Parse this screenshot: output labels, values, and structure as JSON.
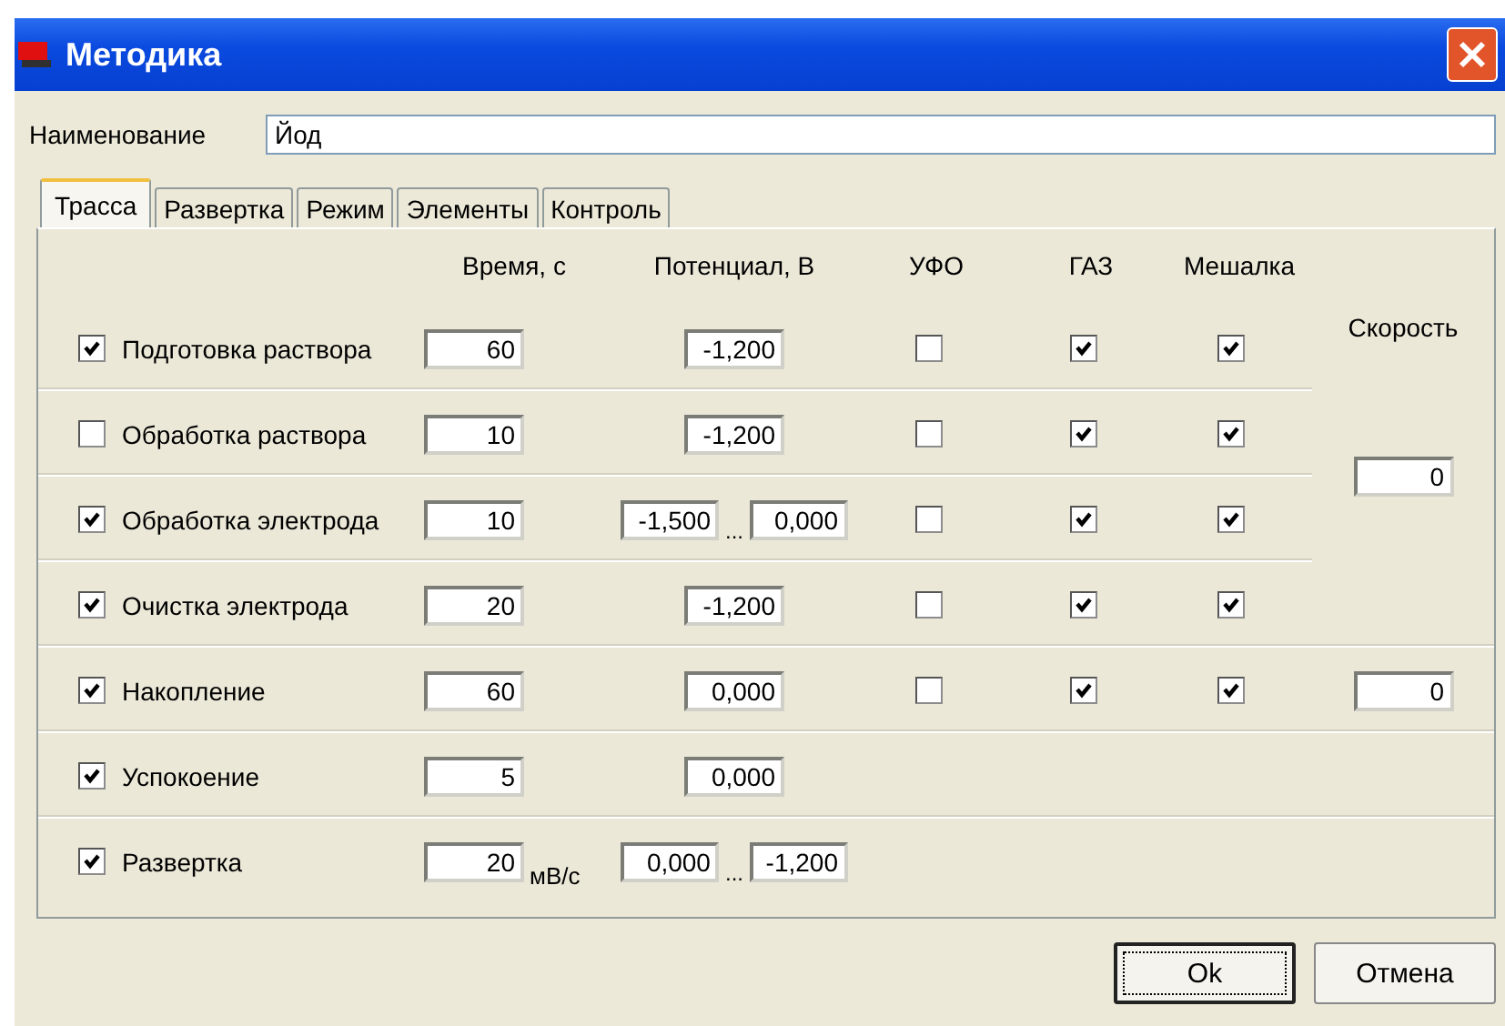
{
  "window": {
    "title": "Методика"
  },
  "name_field": {
    "label": "Наименование",
    "value": "Йод"
  },
  "tabs": [
    {
      "label": "Трасса",
      "selected": true
    },
    {
      "label": "Развертка",
      "selected": false
    },
    {
      "label": "Режим",
      "selected": false
    },
    {
      "label": "Элементы",
      "selected": false
    },
    {
      "label": "Контроль",
      "selected": false
    }
  ],
  "columns": {
    "time": "Время, с",
    "potential": "Потенциал, В",
    "ufo": "УФО",
    "gas": "ГАЗ",
    "mixer": "Мешалка",
    "speed": "Скорость"
  },
  "rows": [
    {
      "label": "Подготовка раствора",
      "checked": true,
      "time": "60",
      "potential": [
        "-1,200"
      ],
      "ufo": false,
      "gas": true,
      "mixer": true
    },
    {
      "label": "Обработка раствора",
      "checked": false,
      "time": "10",
      "potential": [
        "-1,200"
      ],
      "ufo": false,
      "gas": true,
      "mixer": true,
      "speed": "0"
    },
    {
      "label": "Обработка электрода",
      "checked": true,
      "time": "10",
      "potential": [
        "-1,500",
        "0,000"
      ],
      "range_mark": "...",
      "ufo": false,
      "gas": true,
      "mixer": true
    },
    {
      "label": "Очистка электрода",
      "checked": true,
      "time": "20",
      "potential": [
        "-1,200"
      ],
      "ufo": false,
      "gas": true,
      "mixer": true
    },
    {
      "label": "Накопление",
      "checked": true,
      "time": "60",
      "potential": [
        "0,000"
      ],
      "ufo": false,
      "gas": true,
      "mixer": true,
      "speed": "0"
    },
    {
      "label": "Успокоение",
      "checked": true,
      "time": "5",
      "potential": [
        "0,000"
      ]
    },
    {
      "label": "Развертка",
      "checked": true,
      "time": "20",
      "time_unit": "мВ/с",
      "potential": [
        "0,000",
        "-1,200"
      ],
      "range_mark": "..."
    }
  ],
  "buttons": [
    {
      "label": "Ok",
      "default": true
    },
    {
      "label": "Отмена",
      "default": false
    }
  ]
}
